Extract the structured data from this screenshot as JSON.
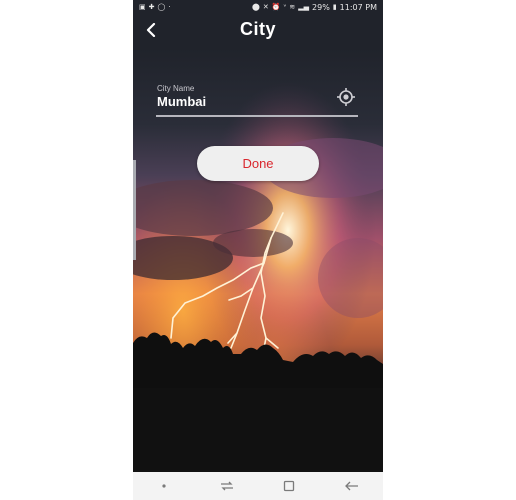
{
  "statusbar": {
    "left_icons": [
      "gallery-icon",
      "plus-app-icon",
      "whatsapp-icon",
      "dot-icon"
    ],
    "right_icons": [
      "location-icon",
      "mute-icon",
      "alarm-icon",
      "volte-icon",
      "wifi-icon",
      "signal-icon"
    ],
    "battery": "29%",
    "time": "11:07 PM"
  },
  "appbar": {
    "title": "City",
    "back_icon": "back-arrow-icon"
  },
  "city_field": {
    "label": "City Name",
    "value": "Mumbai",
    "locate_icon": "gps-target-icon"
  },
  "done_button": {
    "label": "Done",
    "text_color": "#d9272e"
  },
  "navbar": {
    "icons": [
      "nav-dot-icon",
      "recent-apps-icon",
      "home-icon",
      "back-icon"
    ]
  },
  "colors": {
    "background": "#20232b",
    "sky_glow": "#f0a24a",
    "lightning": "#fff2d6"
  }
}
